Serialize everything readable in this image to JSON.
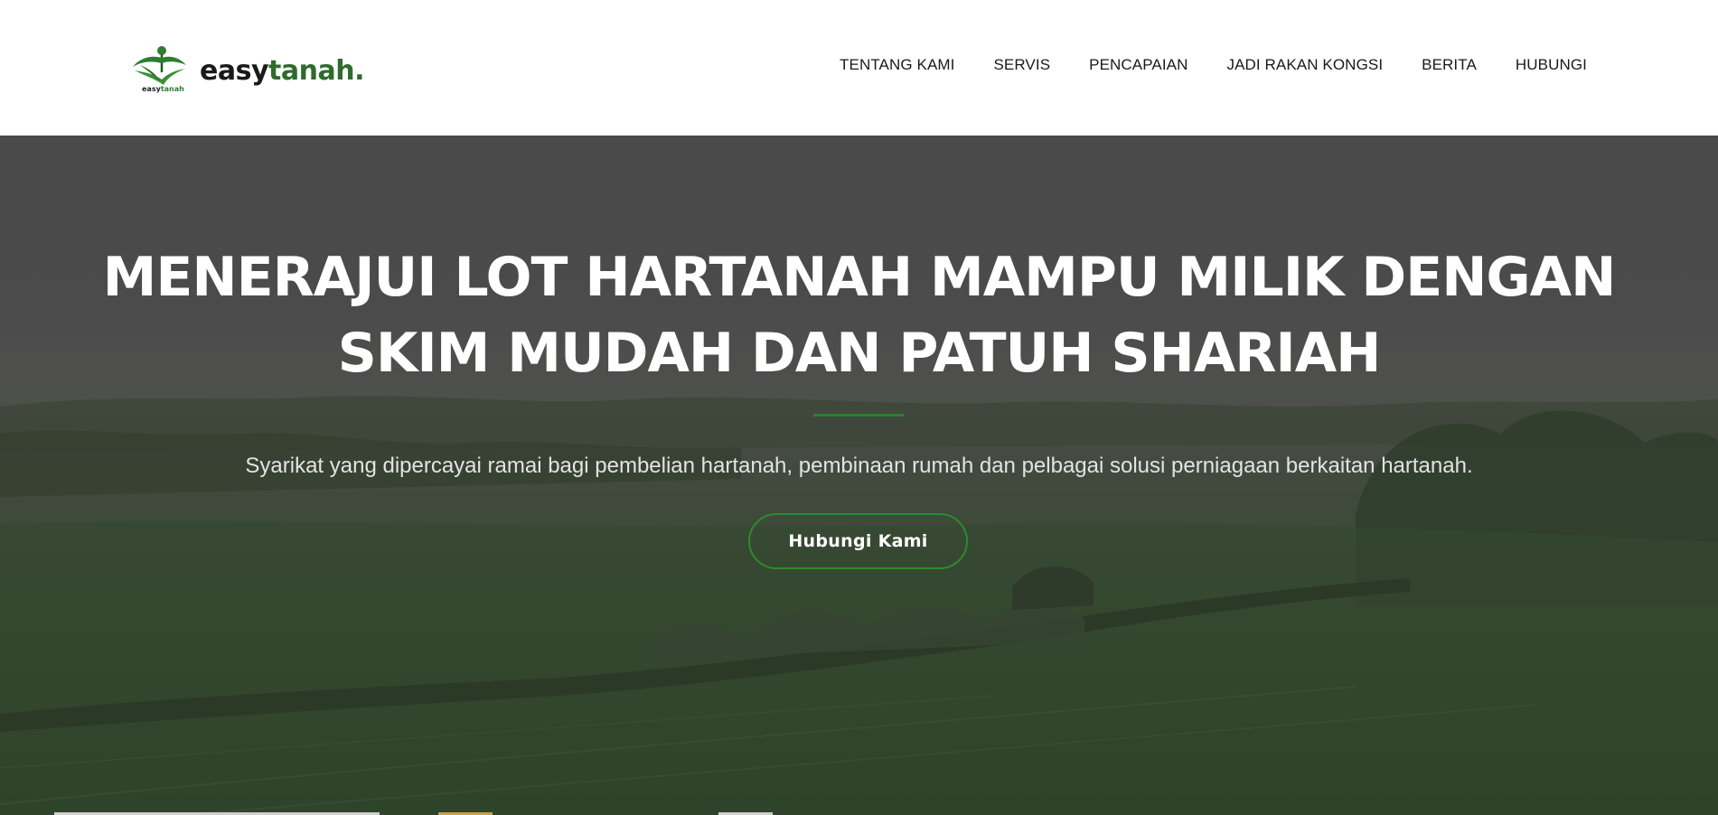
{
  "header": {
    "logo": {
      "small_text_part1": "easy",
      "small_text_part2": "tanah",
      "wordmark_part1": "easy",
      "wordmark_part2": "tanah",
      "wordmark_part3": "."
    },
    "nav": [
      {
        "label": "TENTANG KAMI"
      },
      {
        "label": "SERVIS"
      },
      {
        "label": "PENCAPAIAN"
      },
      {
        "label": "JADI RAKAN KONGSI"
      },
      {
        "label": "BERITA"
      },
      {
        "label": "HUBUNGI"
      }
    ]
  },
  "hero": {
    "headline_line1": "MENERAJUI LOT HARTANAH MAMPU MILIK DENGAN",
    "headline_line2": "SKIM MUDAH DAN PATUH SHARIAH",
    "subtitle": "Syarikat yang dipercayai ramai bagi pembelian hartanah, pembinaan rumah dan pelbagai solusi perniagaan berkaitan hartanah.",
    "cta_label": "Hubungi Kami"
  },
  "colors": {
    "brand_green": "#2f6b2c",
    "accent_green": "#2e8b2e",
    "overlay": "#494949"
  }
}
